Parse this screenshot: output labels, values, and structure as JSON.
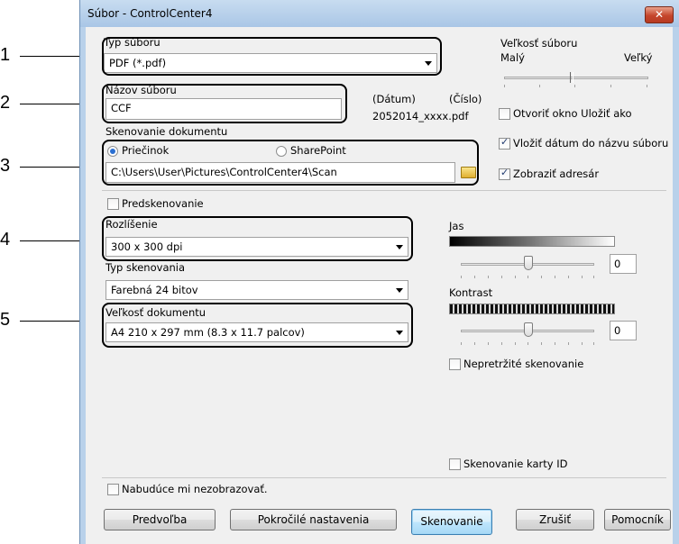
{
  "window": {
    "title": "Súbor - ControlCenter4",
    "close_icon": "close-icon"
  },
  "callouts": [
    "1",
    "2",
    "3",
    "4",
    "5"
  ],
  "file_type": {
    "label": "Typ súboru",
    "value": "PDF (*.pdf)"
  },
  "file_size": {
    "label": "Veľkosť súboru",
    "small": "Malý",
    "large": "Veľký",
    "level": 0.6
  },
  "file_name": {
    "label": "Názov súboru",
    "value": "CCF",
    "date_label": "(Dátum)",
    "number_label": "(Číslo)",
    "preview": "2052014_xxxx.pdf"
  },
  "options_right": {
    "open_save_as": {
      "label": "Otvoriť okno Uložiť ako",
      "checked": false
    },
    "insert_date": {
      "label": "Vložiť dátum do názvu súboru",
      "checked": true
    },
    "show_folder": {
      "label": "Zobraziť adresár",
      "checked": true
    }
  },
  "destination": {
    "label": "Skenovanie dokumentu",
    "folder": "Priečinok",
    "sharepoint": "SharePoint",
    "path": "C:\\Users\\User\\Pictures\\ControlCenter4\\Scan",
    "folder_icon": "folder-icon"
  },
  "prescan": {
    "label": "Predskenovanie",
    "checked": false
  },
  "resolution": {
    "label": "Rozlíšenie",
    "value": "300 x 300 dpi"
  },
  "scan_type": {
    "label": "Typ skenovania",
    "value": "Farebná 24 bitov"
  },
  "doc_size": {
    "label": "Veľkosť dokumentu",
    "value": "A4 210 x 297 mm (8.3 x 11.7 palcov)"
  },
  "brightness": {
    "label": "Jas",
    "value": "0"
  },
  "contrast": {
    "label": "Kontrast",
    "value": "0"
  },
  "continuous": {
    "label": "Nepretržité skenovanie",
    "checked": false
  },
  "id_card": {
    "label": "Skenovanie karty ID",
    "checked": false
  },
  "dont_show": {
    "label": "Nabudúce mi nezobrazovať.",
    "checked": false
  },
  "buttons": {
    "defaults": "Predvoľba",
    "advanced": "Pokročilé nastavenia",
    "scan": "Skenovanie",
    "cancel": "Zrušiť",
    "help": "Pomocník"
  }
}
